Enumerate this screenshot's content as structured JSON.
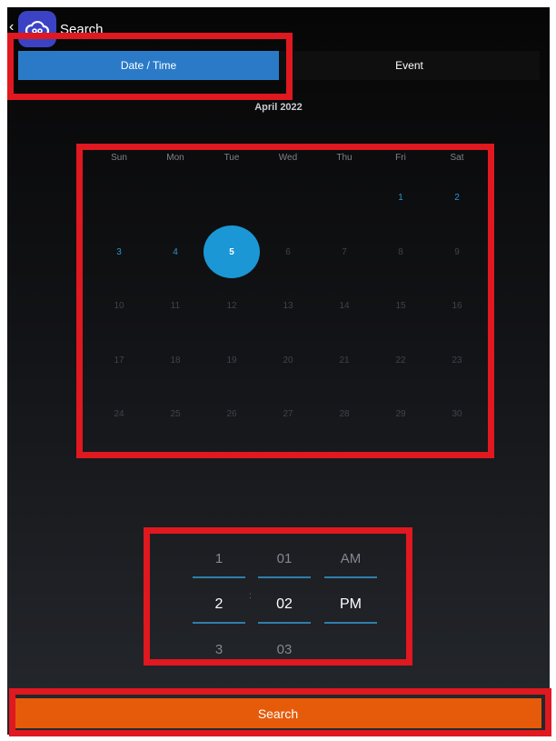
{
  "header": {
    "title": "Search"
  },
  "tabs": [
    {
      "label": "Date / Time",
      "active": true
    },
    {
      "label": "Event",
      "active": false
    }
  ],
  "calendar": {
    "month": "April 2022",
    "weekdays": [
      "Sun",
      "Mon",
      "Tue",
      "Wed",
      "Thu",
      "Fri",
      "Sat"
    ],
    "weeks": [
      [
        "",
        "",
        "",
        "",
        "",
        "1",
        "2"
      ],
      [
        "3",
        "4",
        "5",
        "6",
        "7",
        "8",
        "9"
      ],
      [
        "10",
        "11",
        "12",
        "13",
        "14",
        "15",
        "16"
      ],
      [
        "17",
        "18",
        "19",
        "20",
        "21",
        "22",
        "23"
      ],
      [
        "24",
        "25",
        "26",
        "27",
        "28",
        "29",
        "30"
      ]
    ],
    "available_days": [
      "1",
      "2",
      "3",
      "4"
    ],
    "selected_day": "5"
  },
  "time_picker": {
    "hour": {
      "prev": "1",
      "current": "2",
      "next": "3"
    },
    "minute": {
      "prev": "01",
      "current": "02",
      "next": "03"
    },
    "ampm": {
      "prev": "AM",
      "current": "PM"
    },
    "separator": ":"
  },
  "search_button": {
    "label": "Search"
  },
  "colors": {
    "active_tab": "#2a7ac8",
    "selected_day": "#1b97d5",
    "search_button": "#e65b0a",
    "highlight_box": "#e0181f"
  }
}
